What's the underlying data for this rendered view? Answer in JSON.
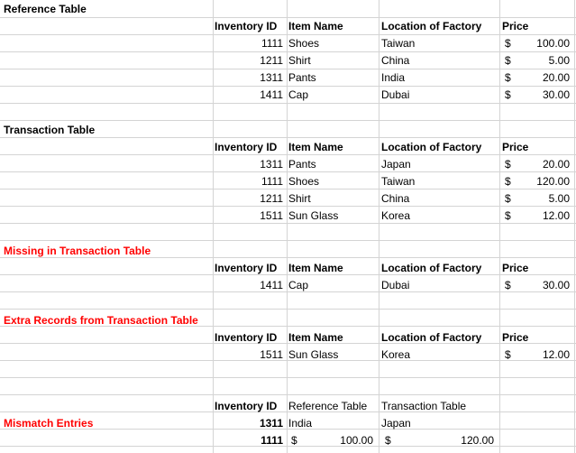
{
  "reference_section": {
    "title": "Reference Table",
    "headers": [
      "Inventory ID",
      "Item Name",
      "Location of Factory",
      "Price"
    ],
    "rows": [
      {
        "id": "1111",
        "item": "Shoes",
        "location": "Taiwan",
        "currency": "$",
        "price": "100.00"
      },
      {
        "id": "1211",
        "item": "Shirt",
        "location": "China",
        "currency": "$",
        "price": "5.00"
      },
      {
        "id": "1311",
        "item": "Pants",
        "location": "India",
        "currency": "$",
        "price": "20.00"
      },
      {
        "id": "1411",
        "item": "Cap",
        "location": "Dubai",
        "currency": "$",
        "price": "30.00"
      }
    ]
  },
  "transaction_section": {
    "title": "Transaction Table",
    "headers": [
      "Inventory ID",
      "Item Name",
      "Location of Factory",
      "Price"
    ],
    "rows": [
      {
        "id": "1311",
        "item": "Pants",
        "location": "Japan",
        "currency": "$",
        "price": "20.00"
      },
      {
        "id": "1111",
        "item": "Shoes",
        "location": "Taiwan",
        "currency": "$",
        "price": "120.00"
      },
      {
        "id": "1211",
        "item": "Shirt",
        "location": "China",
        "currency": "$",
        "price": "5.00"
      },
      {
        "id": "1511",
        "item": "Sun Glass",
        "location": "Korea",
        "currency": "$",
        "price": "12.00"
      }
    ]
  },
  "missing_section": {
    "title": "Missing in Transaction Table",
    "headers": [
      "Inventory ID",
      "Item Name",
      "Location of Factory",
      "Price"
    ],
    "rows": [
      {
        "id": "1411",
        "item": "Cap",
        "location": "Dubai",
        "currency": "$",
        "price": "30.00"
      }
    ]
  },
  "extra_section": {
    "title": "Extra Records from Transaction Table",
    "headers": [
      "Inventory ID",
      "Item Name",
      "Location of Factory",
      "Price"
    ],
    "rows": [
      {
        "id": "1511",
        "item": "Sun Glass",
        "location": "Korea",
        "currency": "$",
        "price": "12.00"
      }
    ]
  },
  "mismatch_section": {
    "title": "Mismatch Entries",
    "headers": [
      "Inventory ID",
      "Reference Table",
      "Transaction Table"
    ],
    "rows": [
      {
        "id": "1311",
        "reference": "India",
        "transaction": "Japan"
      },
      {
        "id": "1111",
        "ref_currency": "$",
        "reference": "100.00",
        "trans_currency": "$",
        "transaction": "120.00"
      }
    ]
  },
  "colors": {
    "gridline": "#d4d4d4",
    "title_red": "#ff0000",
    "text": "#000000"
  }
}
